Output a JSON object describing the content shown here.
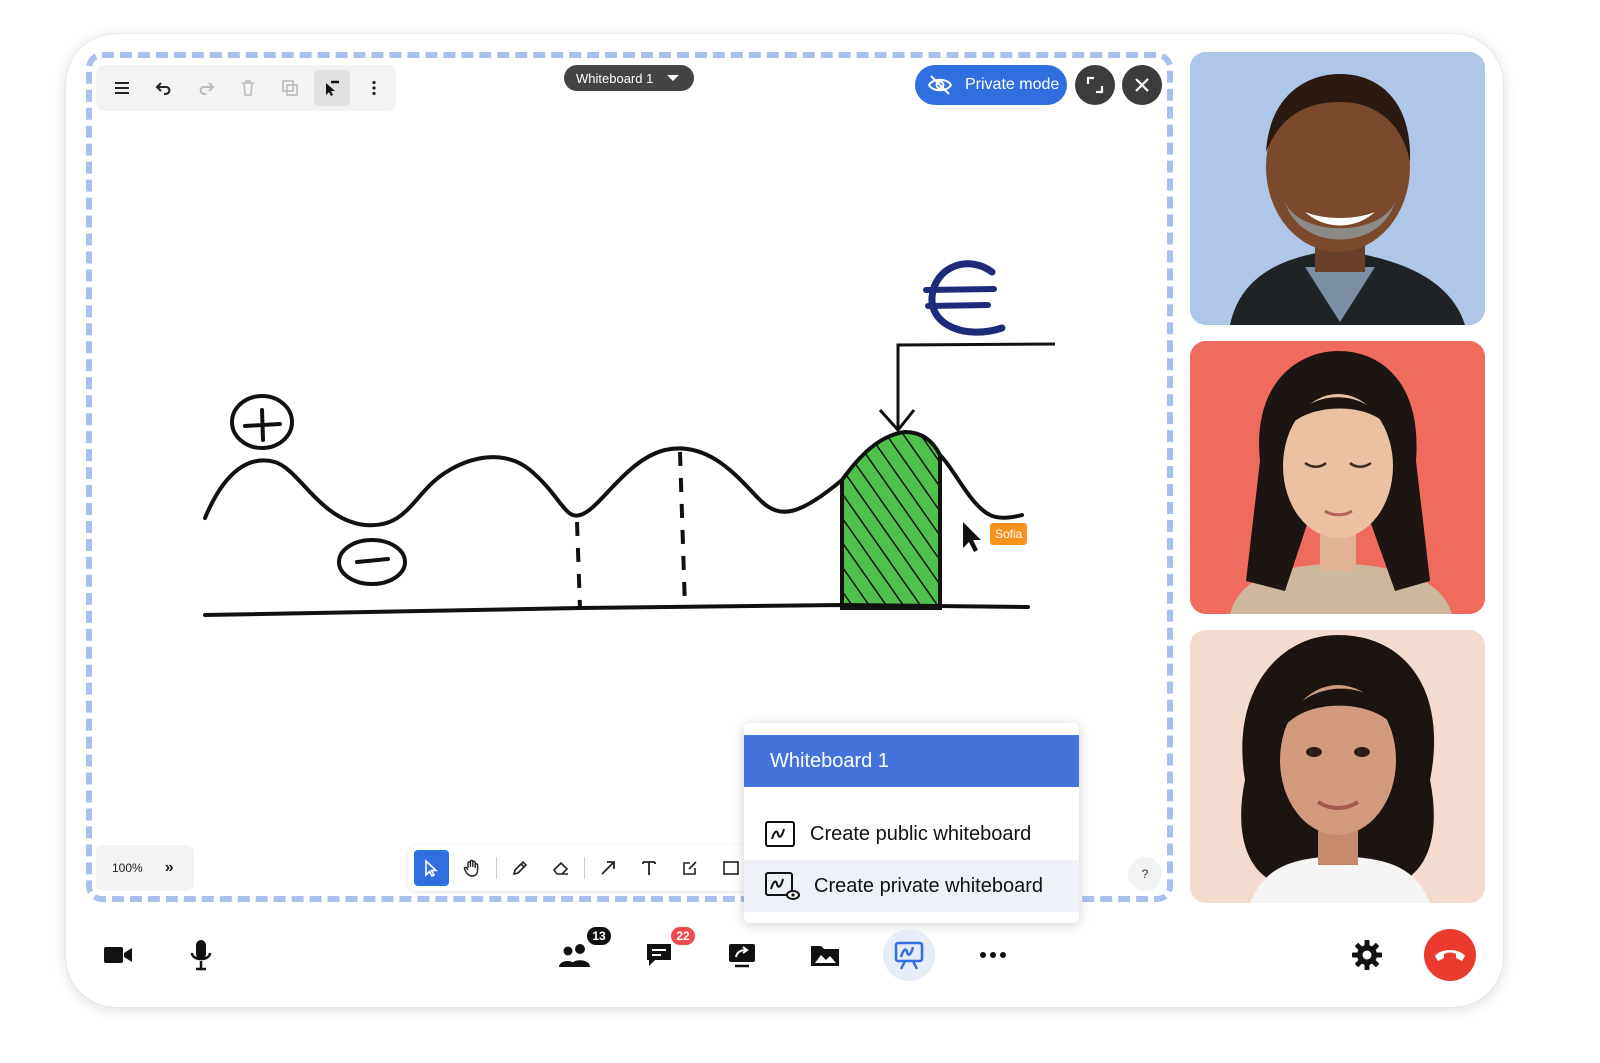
{
  "whiteboard": {
    "selector_label": "Whiteboard 1",
    "private_mode_label": "Private mode",
    "zoom": "100%",
    "help": "?",
    "cursor_user": "Sofia"
  },
  "menu": {
    "title": "Whiteboard 1",
    "items": [
      {
        "label": "Create public whiteboard",
        "icon": "public-whiteboard-icon"
      },
      {
        "label": "Create private whiteboard",
        "icon": "private-whiteboard-icon"
      }
    ]
  },
  "bottom_bar": {
    "participants_count": "13",
    "chat_count": "22"
  },
  "colors": {
    "accent": "#2f6fe0",
    "menu_header": "#4672dc",
    "hangup": "#ea3b2e",
    "hatch_green": "#4fc14a",
    "euro_blue": "#1d2b7a",
    "cursor_label": "#f7941d"
  }
}
